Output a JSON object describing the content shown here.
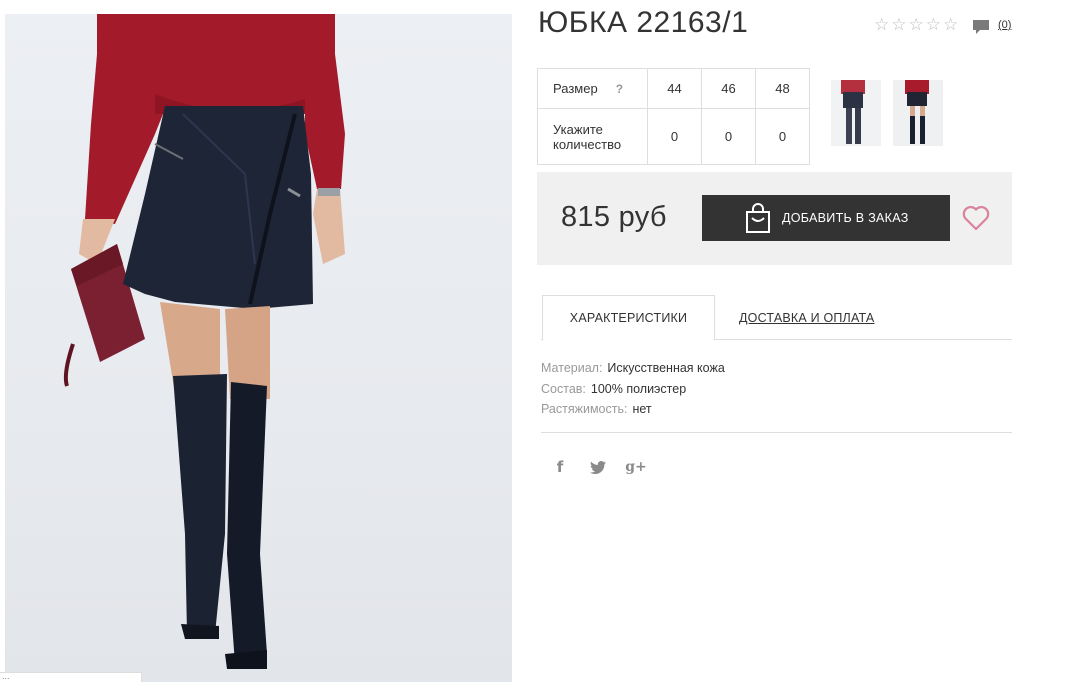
{
  "product": {
    "title": "ЮБКА 22163/1",
    "rating": {
      "stars_filled": 0,
      "stars_total": 5
    },
    "comments_label": "(0)"
  },
  "size_table": {
    "size_label": "Размер",
    "help_mark": "?",
    "quantity_label_line1": "Укажите",
    "quantity_label_line2": "количество",
    "sizes": [
      "44",
      "46",
      "48"
    ],
    "quantities": [
      "0",
      "0",
      "0"
    ]
  },
  "purchase": {
    "price": "815 руб",
    "add_button_label": "ДОБАВИТЬ В ЗАКАЗ",
    "button_color": "#333333",
    "heart_color": "#d9839a"
  },
  "tabs": {
    "active": "ХАРАКТЕРИСТИКИ",
    "delivery": "ДОСТАВКА И ОПЛАТА"
  },
  "specs": [
    {
      "key": "Материал:",
      "value": "Искусственная кожа"
    },
    {
      "key": "Состав:",
      "value": "100% полиэстер"
    },
    {
      "key": "Растяжимость:",
      "value": "нет"
    }
  ],
  "social": {
    "facebook": "f",
    "google": "g+"
  },
  "icons": {
    "star": "star-outline-icon",
    "comment": "speech-bubble-icon",
    "bag": "shopping-bag-icon",
    "heart": "heart-outline-icon",
    "facebook": "facebook-icon",
    "twitter": "twitter-icon",
    "google": "google-plus-icon"
  },
  "corner_tab_text": "..."
}
